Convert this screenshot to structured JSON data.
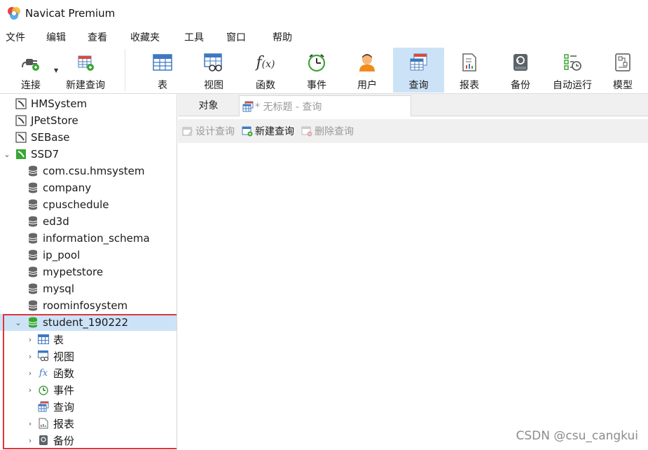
{
  "window": {
    "title": "Navicat Premium"
  },
  "menu": [
    "文件",
    "编辑",
    "查看",
    "收藏夹",
    "工具",
    "窗口",
    "帮助"
  ],
  "toolbar": {
    "connect": "连接",
    "new_query": "新建查询",
    "table": "表",
    "view": "视图",
    "function": "函数",
    "event": "事件",
    "user": "用户",
    "query": "查询",
    "report": "报表",
    "backup": "备份",
    "autorun": "自动运行",
    "model": "模型"
  },
  "tree": {
    "connections": [
      "HMSystem",
      "JPetStore",
      "SEBase",
      "SSD7"
    ],
    "databases": [
      "com.csu.hmsystem",
      "company",
      "cpuschedule",
      "ed3d",
      "information_schema",
      "ip_pool",
      "mypetstore",
      "mysql",
      "roominfosystem",
      "student_190222"
    ],
    "children": [
      "表",
      "视图",
      "函数",
      "事件",
      "查询",
      "报表",
      "备份"
    ]
  },
  "tabs": {
    "objects": "对象",
    "query_tab": "* 无标题 - 查询"
  },
  "subtoolbar": {
    "design": "设计查询",
    "new": "新建查询",
    "delete": "删除查询"
  },
  "watermark": "CSDN @csu_cangkui",
  "colors": {
    "accent": "#cce3f7",
    "highlight_border": "#e0353b",
    "mysql_green": "#3aa635"
  }
}
